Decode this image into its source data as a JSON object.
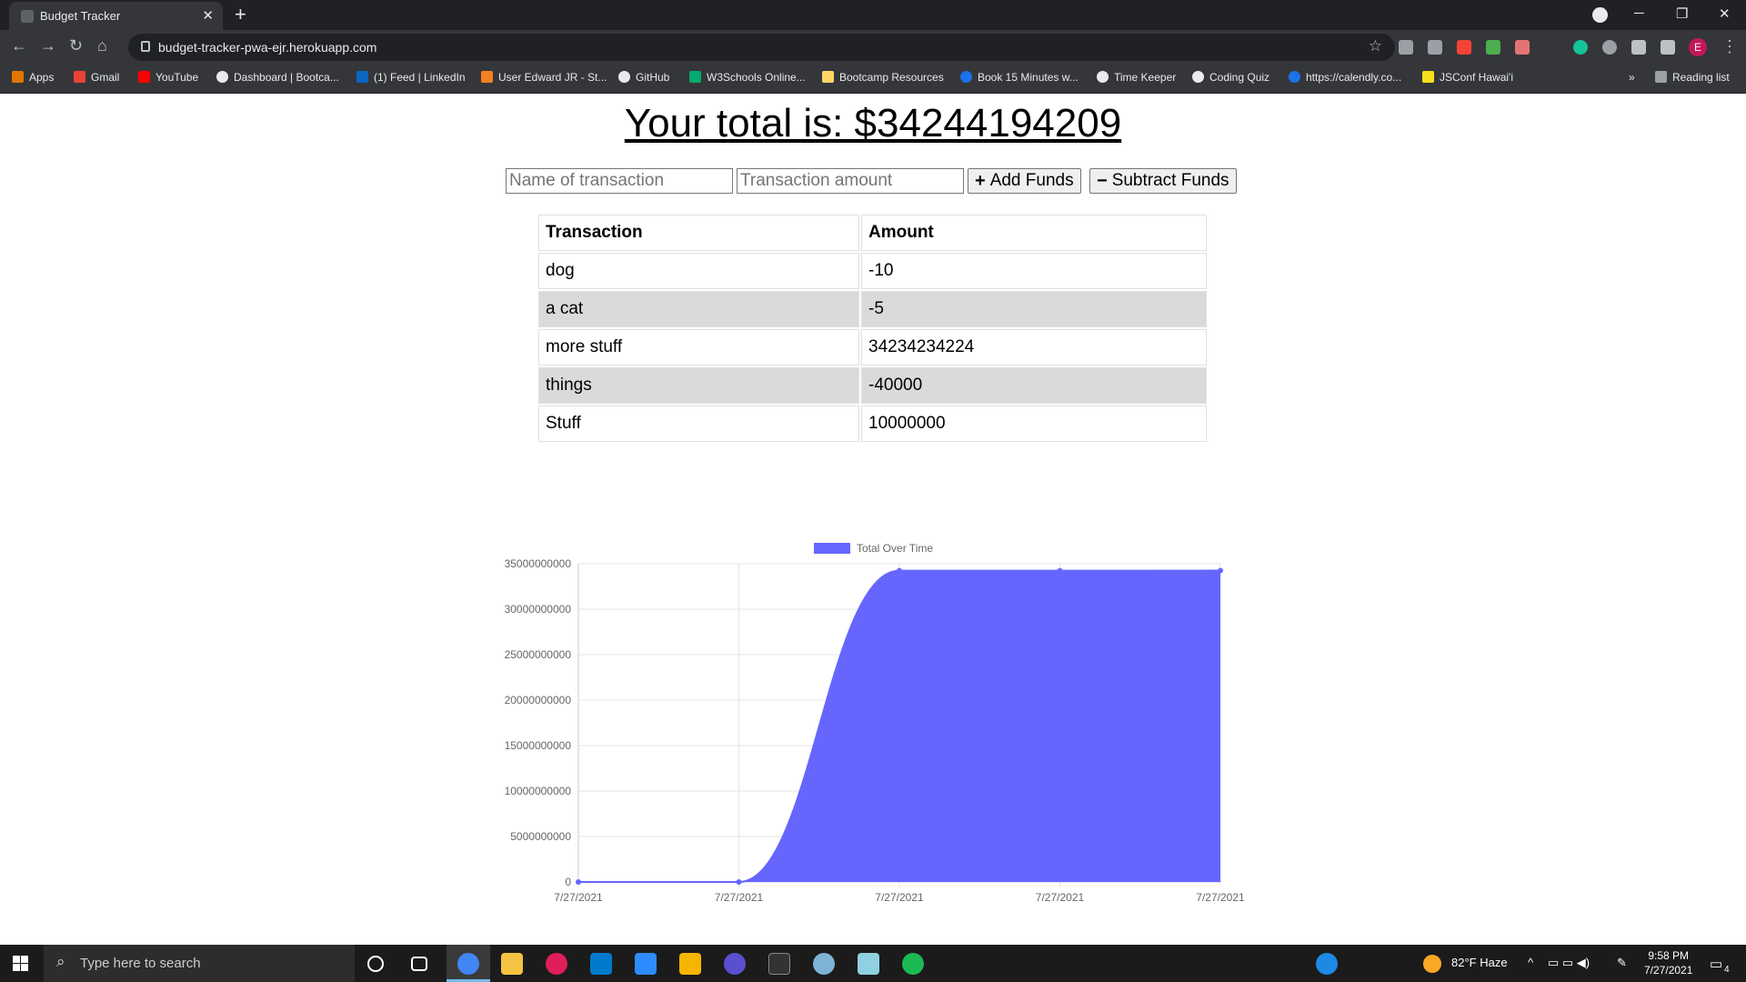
{
  "browser": {
    "tab_title": "Budget Tracker",
    "url": "budget-tracker-pwa-ejr.herokuapp.com",
    "bookmarks": [
      "Apps",
      "Gmail",
      "YouTube",
      "Dashboard | Bootca...",
      "(1) Feed | LinkedIn",
      "User Edward JR - St...",
      "GitHub",
      "W3Schools Online...",
      "Bootcamp Resources",
      "Book 15 Minutes w...",
      "Time Keeper",
      "Coding Quiz",
      "https://calendly.co...",
      "JSConf Hawai'i"
    ],
    "reading_list": "Reading list",
    "profile_initial": "E"
  },
  "page": {
    "total_label": "Your total is: $",
    "total_value": "34244194209",
    "name_placeholder": "Name of transaction",
    "amount_placeholder": "Transaction amount",
    "add_label": "Add Funds",
    "subtract_label": "Subtract Funds",
    "table": {
      "headers": [
        "Transaction",
        "Amount"
      ],
      "rows": [
        [
          "dog",
          "-10"
        ],
        [
          "a cat",
          "-5"
        ],
        [
          "more stuff",
          "34234234224"
        ],
        [
          "things",
          "-40000"
        ],
        [
          "Stuff",
          "10000000"
        ]
      ]
    }
  },
  "chart_data": {
    "type": "area",
    "series": [
      {
        "name": "Total Over Time",
        "values": [
          0,
          0,
          34234234224,
          34234194209,
          34244194209
        ]
      }
    ],
    "x": [
      "7/27/2021",
      "7/27/2021",
      "7/27/2021",
      "7/27/2021",
      "7/27/2021"
    ],
    "yticks": [
      0,
      5000000000,
      10000000000,
      15000000000,
      20000000000,
      25000000000,
      30000000000,
      35000000000
    ],
    "ylim": [
      0,
      35000000000
    ],
    "fill_color": "#6666ff",
    "legend_position": "top"
  },
  "taskbar": {
    "search_placeholder": "Type here to search",
    "weather": "82°F  Haze",
    "time": "9:58 PM",
    "date": "7/27/2021",
    "notifications": "4"
  }
}
